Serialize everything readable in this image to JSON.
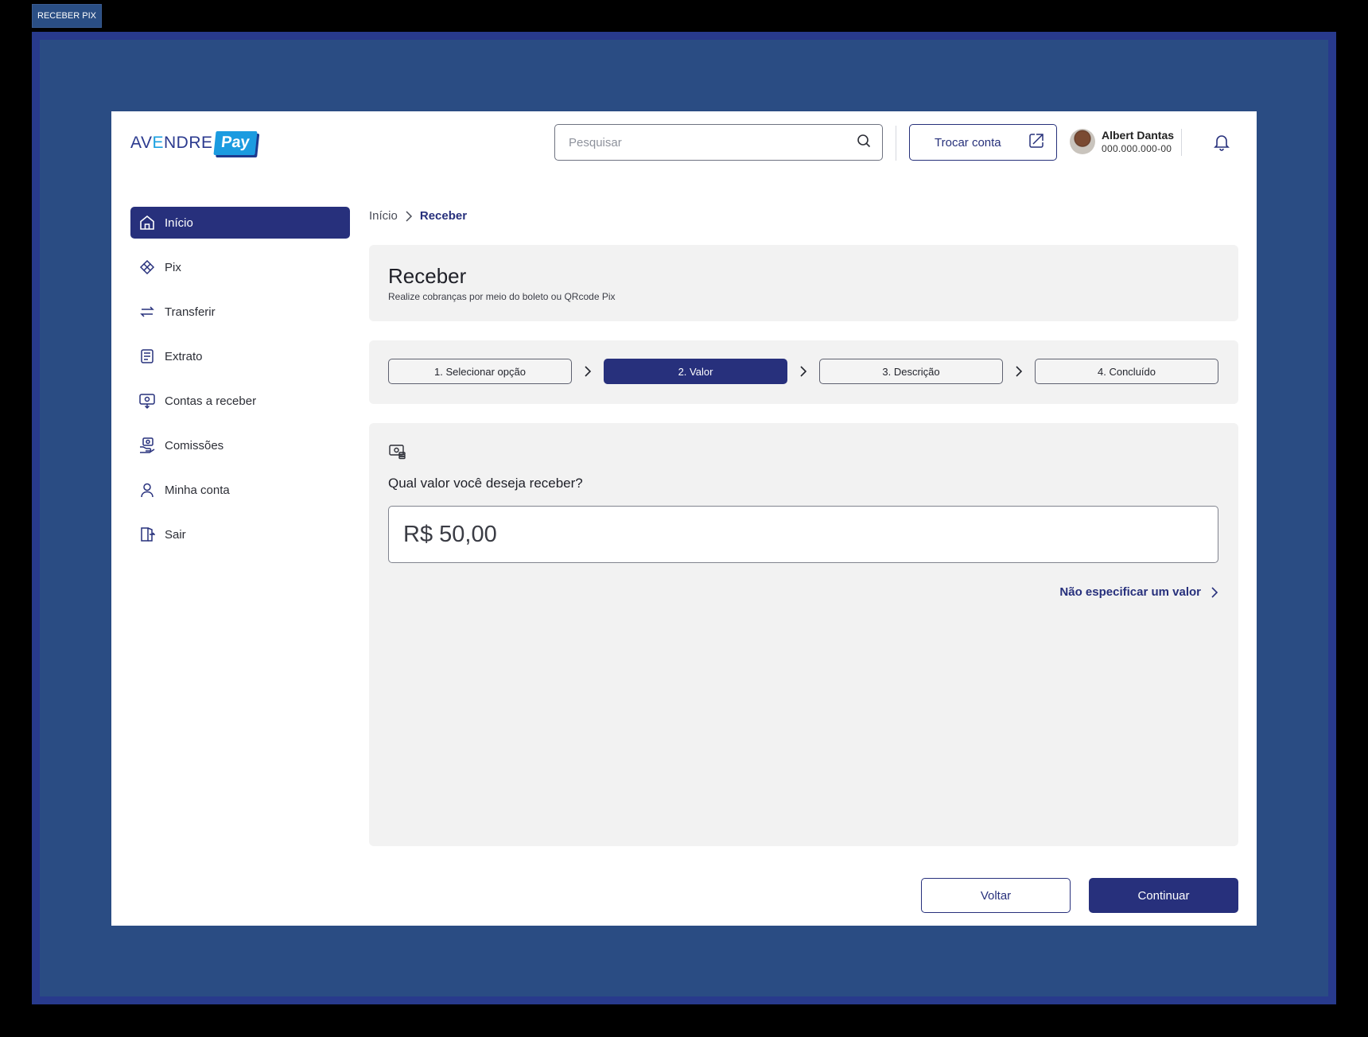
{
  "frame_label": "RECEBER PIX",
  "brand": {
    "name_part1": "AV",
    "name_e": "E",
    "name_part2": "NDRE",
    "pay": "Pay"
  },
  "header": {
    "search_placeholder": "Pesquisar",
    "switch_account_label": "Trocar conta",
    "user_name": "Albert Dantas",
    "user_document": "000.000.000-00"
  },
  "sidebar": {
    "items": [
      {
        "label": "Início",
        "icon": "home-icon",
        "active": true
      },
      {
        "label": "Pix",
        "icon": "pix-icon"
      },
      {
        "label": "Transferir",
        "icon": "transfer-icon"
      },
      {
        "label": "Extrato",
        "icon": "statement-icon"
      },
      {
        "label": "Contas a receber",
        "icon": "receivables-icon"
      },
      {
        "label": "Comissões",
        "icon": "commission-icon"
      },
      {
        "label": "Minha conta",
        "icon": "user-icon"
      },
      {
        "label": "Sair",
        "icon": "logout-icon"
      }
    ]
  },
  "breadcrumb": {
    "home": "Início",
    "current": "Receber"
  },
  "page": {
    "title": "Receber",
    "subtitle": "Realize cobranças por meio do boleto ou QRcode Pix"
  },
  "steps": [
    {
      "label": "1. Selecionar opção"
    },
    {
      "label": "2. Valor",
      "active": true
    },
    {
      "label": "3. Descrição"
    },
    {
      "label": "4. Concluído"
    }
  ],
  "value_form": {
    "question": "Qual valor você deseja receber?",
    "amount": "R$ 50,00",
    "no_value_link": "Não especificar um valor"
  },
  "actions": {
    "back": "Voltar",
    "continue": "Continuar"
  },
  "colors": {
    "primary": "#27307c",
    "accent": "#1b9be0",
    "panel": "#f2f2f2",
    "backdrop": "#2a4c83"
  }
}
